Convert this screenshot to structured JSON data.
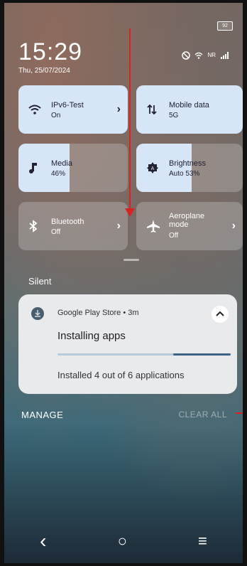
{
  "status": {
    "battery": "92",
    "time": "15:29",
    "date": "Thu, 25/07/2024",
    "network_label": "NR"
  },
  "tiles": [
    {
      "title": "IPv6-Test",
      "sub": "On",
      "icon": "wifi-icon",
      "chevron": "›",
      "state": "light"
    },
    {
      "title": "Mobile data",
      "sub": "5G",
      "icon": "mobile-data-icon",
      "chevron": "",
      "state": "light"
    },
    {
      "title": "Media",
      "sub": "46%",
      "icon": "music-note-icon",
      "chevron": "",
      "state": "light",
      "level": 0.46
    },
    {
      "title": "Brightness",
      "sub": "Auto 53%",
      "icon": "brightness-icon",
      "chevron": "",
      "state": "light",
      "level": 0.53
    },
    {
      "title": "Bluetooth",
      "sub": "Off",
      "icon": "bluetooth-icon",
      "chevron": "›",
      "state": "dim"
    },
    {
      "title": "Aeroplane\nmode",
      "sub": "Off",
      "icon": "airplane-icon",
      "chevron": "›",
      "state": "dim"
    }
  ],
  "section": {
    "label": "Silent"
  },
  "notification": {
    "app": "Google Play Store",
    "dot": "•",
    "age": "3m",
    "title": "Installing apps",
    "body": "Installed 4 out of 6 applications",
    "progress": 0.667
  },
  "actions": {
    "manage": "MANAGE",
    "clear_all": "CLEAR ALL"
  },
  "nav": {
    "back": "‹",
    "home": "○",
    "recents": "≡"
  }
}
